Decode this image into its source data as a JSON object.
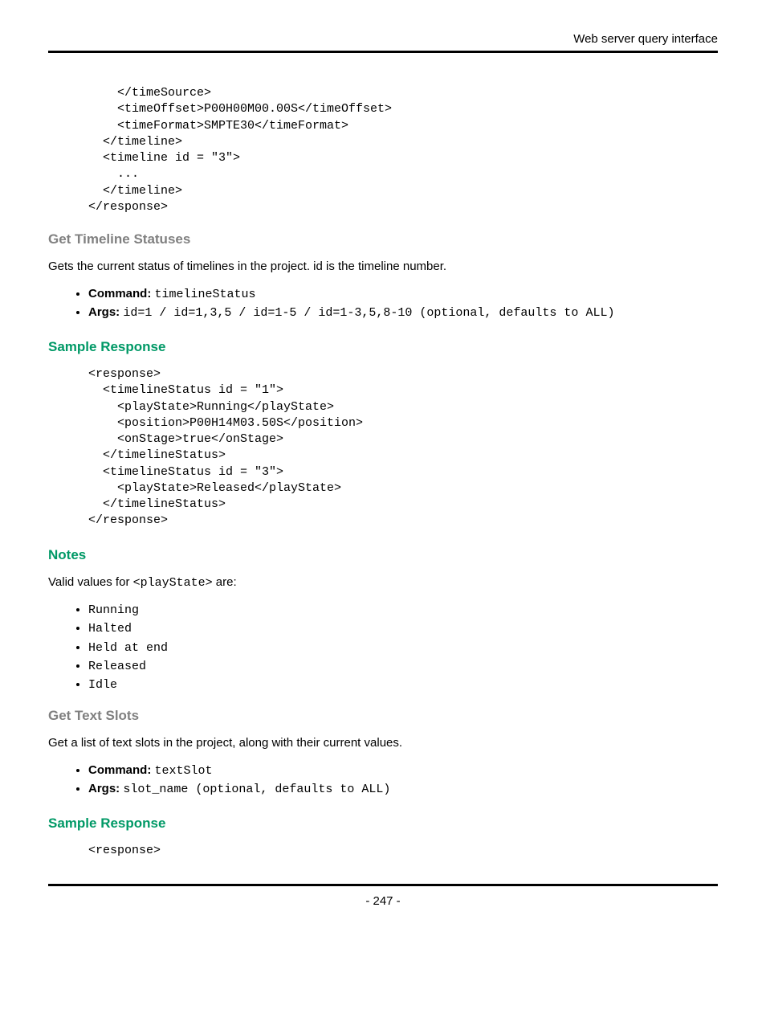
{
  "header": {
    "title_right": "Web server query interface"
  },
  "code1": "    </timeSource>\n    <timeOffset>P00H00M00.00S</timeOffset>\n    <timeFormat>SMPTE30</timeFormat>\n  </timeline>\n  <timeline id = \"3\">\n    ...\n  </timeline>\n</response>",
  "section1": {
    "heading": "Get Timeline Statuses",
    "desc": "Gets the current status of timelines in the project. id is the timeline number.",
    "cmd_label": "Command:",
    "cmd_value": "timelineStatus",
    "args_label": "Args:",
    "args_value": "id=1 / id=1,3,5 / id=1-5 / id=1-3,5,8-10 (optional, defaults to ALL)"
  },
  "sample1_heading": "Sample Response",
  "code2": "<response>\n  <timelineStatus id = \"1\">\n    <playState>Running</playState>\n    <position>P00H14M03.50S</position>\n    <onStage>true</onStage>\n  </timelineStatus>\n  <timelineStatus id = \"3\">\n    <playState>Released</playState>\n  </timelineStatus>\n</response>",
  "notes": {
    "heading": "Notes",
    "intro_pre": "Valid values for ",
    "intro_code": "<playState>",
    "intro_post": " are:",
    "values": [
      "Running",
      "Halted",
      "Held at end",
      "Released",
      "Idle"
    ]
  },
  "section2": {
    "heading": "Get Text Slots",
    "desc": "Get a list of text slots in the project, along with their current values.",
    "cmd_label": "Command:",
    "cmd_value": "textSlot",
    "args_label": "Args:",
    "args_value": "slot_name (optional, defaults to ALL)"
  },
  "sample2_heading": "Sample Response",
  "code3": "<response>",
  "footer": {
    "page_number": "- 247 -"
  }
}
